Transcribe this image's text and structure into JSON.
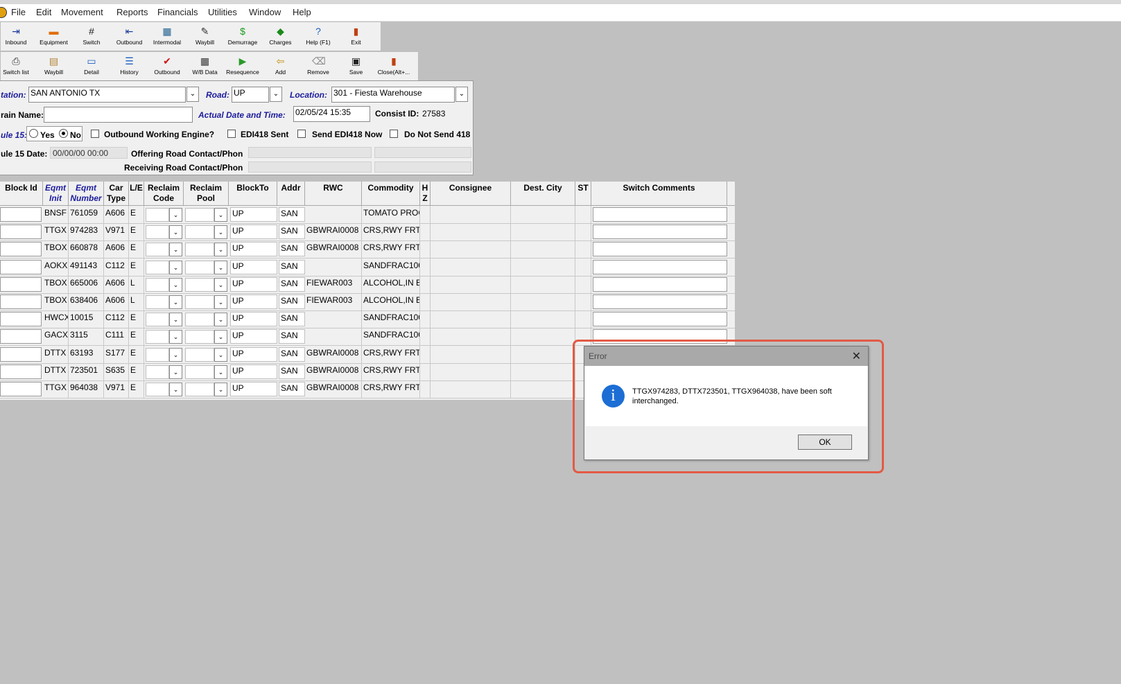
{
  "menu": [
    "File",
    "Edit",
    "Movement",
    "Reports",
    "Financials",
    "Utilities",
    "Window",
    "Help"
  ],
  "toolbar1": [
    {
      "label": "Inbound",
      "icon": "inbound-icon",
      "glyph": "⇥",
      "color": "#1c3c9c"
    },
    {
      "label": "Equipment",
      "icon": "equipment-icon",
      "glyph": "▬",
      "color": "#e07010"
    },
    {
      "label": "Switch",
      "icon": "switch-icon",
      "glyph": "#",
      "color": "#222"
    },
    {
      "label": "Outbound",
      "icon": "outbound-icon",
      "glyph": "⇤",
      "color": "#1c3c9c"
    },
    {
      "label": "Intermodal",
      "icon": "intermodal-icon",
      "glyph": "▦",
      "color": "#1c5c8c"
    },
    {
      "label": "Waybill",
      "icon": "waybill-icon",
      "glyph": "✎",
      "color": "#333"
    },
    {
      "label": "Demurrage",
      "icon": "demurrage-icon",
      "glyph": "$",
      "color": "#1a9a1a"
    },
    {
      "label": "Charges",
      "icon": "charges-icon",
      "glyph": "◆",
      "color": "#1a8a1a"
    },
    {
      "label": "Help (F1)",
      "icon": "help-icon",
      "glyph": "?",
      "color": "#1c5cc0"
    },
    {
      "label": "Exit",
      "icon": "exit-icon",
      "glyph": "▮",
      "color": "#c04010"
    }
  ],
  "toolbar2": [
    {
      "label": "Switch list",
      "icon": "printer-icon",
      "glyph": "⎙",
      "color": "#333"
    },
    {
      "label": "Waybill",
      "icon": "waybill-doc-icon",
      "glyph": "▤",
      "color": "#b08030"
    },
    {
      "label": "Detail",
      "icon": "detail-icon",
      "glyph": "▭",
      "color": "#1c5cc0"
    },
    {
      "label": "History",
      "icon": "history-icon",
      "glyph": "☰",
      "color": "#1c5cc0"
    },
    {
      "label": "Outbound",
      "icon": "checkmark-icon",
      "glyph": "✔",
      "color": "#d01010"
    },
    {
      "label": "W/B Data",
      "icon": "wb-data-icon",
      "glyph": "▦",
      "color": "#333"
    },
    {
      "label": "Resequence",
      "icon": "resequence-icon",
      "glyph": "▶",
      "color": "#2a9a2a"
    },
    {
      "label": "Add",
      "icon": "add-icon",
      "glyph": "⇦",
      "color": "#c09010"
    },
    {
      "label": "Remove",
      "icon": "remove-icon",
      "glyph": "⌫",
      "color": "#888"
    },
    {
      "label": "Save",
      "icon": "save-icon",
      "glyph": "▣",
      "color": "#222"
    },
    {
      "label": "Close(Alt+...",
      "icon": "close-door-icon",
      "glyph": "▮",
      "color": "#c04010"
    }
  ],
  "form": {
    "station_label": "tation:",
    "station_value": "SAN ANTONIO TX",
    "road_label": "Road:",
    "road_value": "UP",
    "location_label": "Location:",
    "location_value": "301 - Fiesta Warehouse",
    "train_label": "rain Name:",
    "train_value": "",
    "actual_label": "Actual Date and Time:",
    "actual_value": "02/05/24 15:35",
    "consist_label": "Consist ID:",
    "consist_value": "27583",
    "rule15_label": "ule 15:",
    "yes_label": "Yes",
    "no_label": "No",
    "outbound_engine_label": "Outbound Working Engine?",
    "edi_sent_label": "EDI418 Sent",
    "send_edi_label": "Send EDI418 Now",
    "donot_label": "Do Not Send 418",
    "rule15date_label": "ule 15 Date:",
    "rule15date_value": "00/00/00 00:00",
    "offering_label": "Offering Road Contact/Phon",
    "receiving_label": "Receiving Road Contact/Phon"
  },
  "grid": {
    "headers": {
      "block": "Block Id",
      "init": "Eqmt Init",
      "number": "Eqmt Number",
      "cartype": "Car Type",
      "le": "L/E",
      "reclaim": "Reclaim Code",
      "pool": "Reclaim Pool",
      "blockto": "BlockTo",
      "addr": "Addr",
      "rwc": "RWC",
      "commodity": "Commodity",
      "hz": "H Z",
      "consignee": "Consignee",
      "destcity": "Dest. City",
      "st": "ST",
      "comments": "Switch Comments"
    },
    "rows": [
      {
        "init": "BNSF",
        "number": "761059",
        "cartype": "A606",
        "le": "E",
        "blockto": "UP",
        "addr": "SAN",
        "rwc": "",
        "commodity": "TOMATO PROC"
      },
      {
        "init": "TTGX",
        "number": "974283",
        "cartype": "V971",
        "le": "E",
        "blockto": "UP",
        "addr": "SAN",
        "rwc": "GBWRAI0008",
        "commodity": "CRS,RWY FRT,"
      },
      {
        "init": "TBOX",
        "number": "660878",
        "cartype": "A606",
        "le": "E",
        "blockto": "UP",
        "addr": "SAN",
        "rwc": "GBWRAI0008",
        "commodity": "CRS,RWY FRT,"
      },
      {
        "init": "AOKX",
        "number": "491143",
        "cartype": "C112",
        "le": "E",
        "blockto": "UP",
        "addr": "SAN",
        "rwc": "",
        "commodity": "SANDFRAC100"
      },
      {
        "init": "TBOX",
        "number": "665006",
        "cartype": "A606",
        "le": "L",
        "blockto": "UP",
        "addr": "SAN",
        "rwc": "FIEWAR003",
        "commodity": "ALCOHOL,IN B"
      },
      {
        "init": "TBOX",
        "number": "638406",
        "cartype": "A606",
        "le": "L",
        "blockto": "UP",
        "addr": "SAN",
        "rwc": "FIEWAR003",
        "commodity": "ALCOHOL,IN B"
      },
      {
        "init": "HWCX",
        "number": "10015",
        "cartype": "C112",
        "le": "E",
        "blockto": "UP",
        "addr": "SAN",
        "rwc": "",
        "commodity": "SANDFRAC100"
      },
      {
        "init": "GACX",
        "number": "3115",
        "cartype": "C111",
        "le": "E",
        "blockto": "UP",
        "addr": "SAN",
        "rwc": "",
        "commodity": "SANDFRAC100"
      },
      {
        "init": "DTTX",
        "number": "63193",
        "cartype": "S177",
        "le": "E",
        "blockto": "UP",
        "addr": "SAN",
        "rwc": "GBWRAI0008",
        "commodity": "CRS,RWY FRT,"
      },
      {
        "init": "DTTX",
        "number": "723501",
        "cartype": "S635",
        "le": "E",
        "blockto": "UP",
        "addr": "SAN",
        "rwc": "GBWRAI0008",
        "commodity": "CRS,RWY FRT,"
      },
      {
        "init": "TTGX",
        "number": "964038",
        "cartype": "V971",
        "le": "E",
        "blockto": "UP",
        "addr": "SAN",
        "rwc": "GBWRAI0008",
        "commodity": "CRS,RWY FRT,"
      }
    ]
  },
  "dialog": {
    "title": "Error",
    "close": "✕",
    "icon_glyph": "i",
    "message": "TTGX974283, DTTX723501, TTGX964038, have been soft interchanged.",
    "ok_label": "OK"
  },
  "colors": {
    "highlight": "#e35a45",
    "info_blue": "#1c6ed4",
    "label_blue": "#1c1c9c"
  }
}
